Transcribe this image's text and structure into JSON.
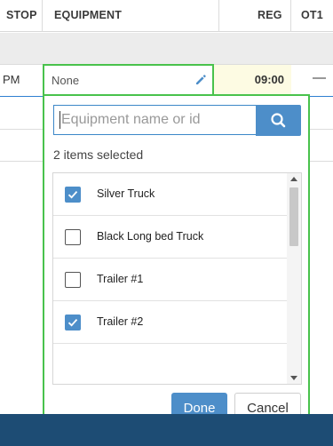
{
  "columns": {
    "stop": "STOP",
    "equipment": "EQUIPMENT",
    "reg": "REG",
    "ot1": "OT1"
  },
  "row": {
    "time_suffix": "PM",
    "equipment_value": "None",
    "reg_value": "09:00",
    "ot1_value": "—"
  },
  "dropdown": {
    "search_placeholder": "Equipment name or id",
    "selected_count_text": "2 items selected",
    "items": [
      {
        "label": "Silver Truck",
        "checked": true
      },
      {
        "label": "Black Long bed Truck",
        "checked": false
      },
      {
        "label": "Trailer #1",
        "checked": false
      },
      {
        "label": "Trailer #2",
        "checked": true
      }
    ],
    "done_label": "Done",
    "cancel_label": "Cancel"
  },
  "colors": {
    "accent_blue": "#4d8ec9",
    "focus_green": "#49c24c",
    "footer_navy": "#1d4c74",
    "reg_highlight": "#fdfbe3"
  },
  "icons": {
    "edit": "pencil-icon",
    "search": "search-icon",
    "check": "checkmark-icon",
    "scroll_up": "chevron-up-icon",
    "scroll_down": "chevron-down-icon"
  }
}
